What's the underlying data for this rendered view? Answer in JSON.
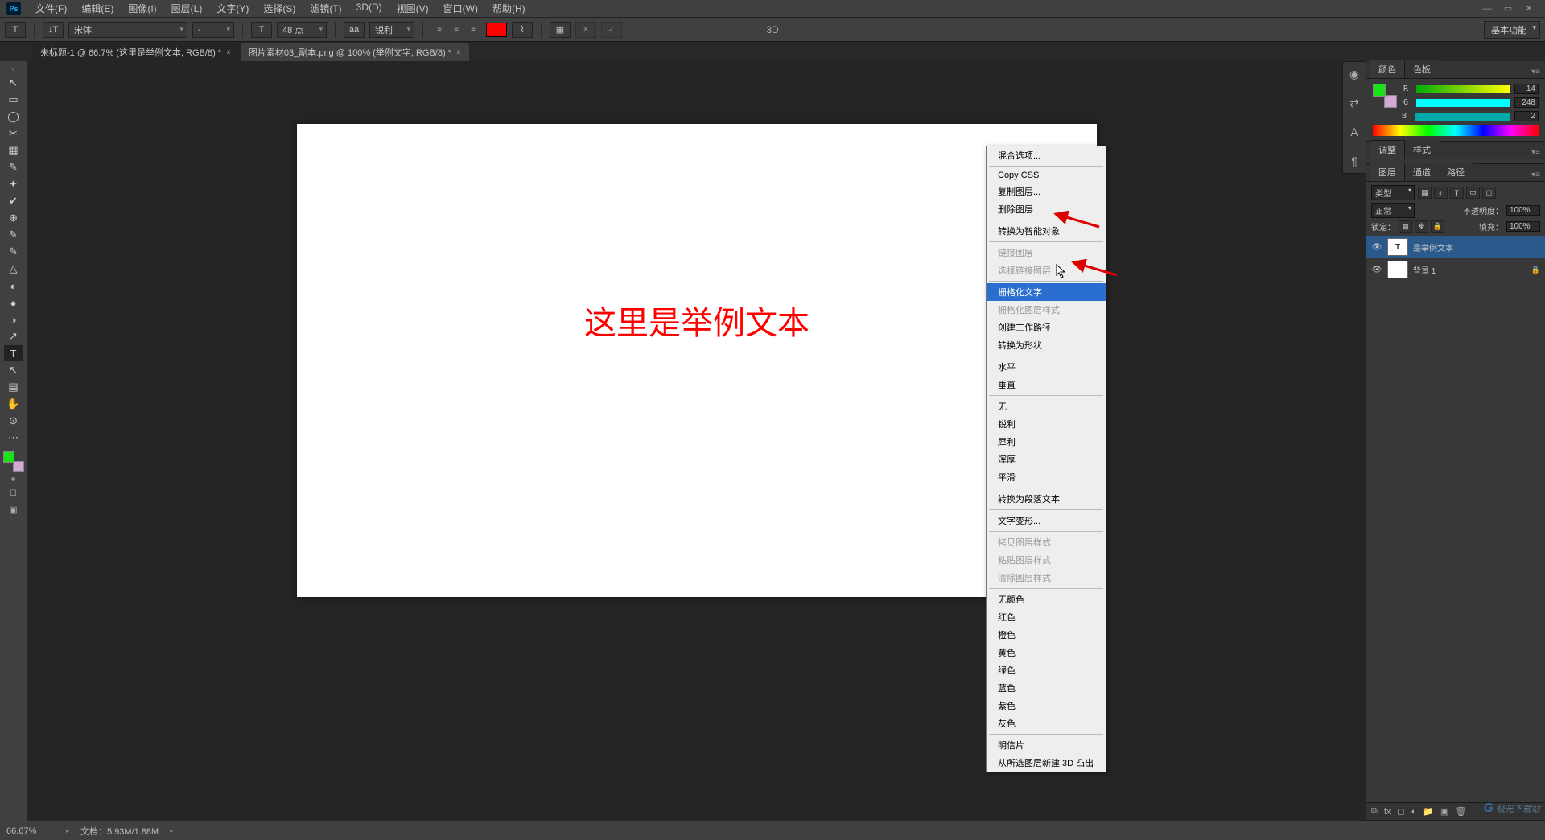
{
  "menu": {
    "file": "文件(F)",
    "edit": "编辑(E)",
    "image": "图像(I)",
    "layer": "图层(L)",
    "type": "文字(Y)",
    "select": "选择(S)",
    "filter": "滤镜(T)",
    "threeD": "3D(D)",
    "view": "视图(V)",
    "window": "窗口(W)",
    "help": "帮助(H)"
  },
  "winctrl": {
    "min": "—",
    "max": "▭",
    "close": "✕"
  },
  "options": {
    "toolT": "T",
    "orientT": "↓T",
    "font": "宋体",
    "fontStyle": "-",
    "sizeT": "T",
    "size": "48 点",
    "aa": "aa",
    "aaMode": "锐利",
    "colorSwatch": "#ff0000",
    "threeDLabel": "3D",
    "workspace": "基本功能"
  },
  "tabs": {
    "t1": "未标题-1 @ 66.7% (这里是举例文本, RGB/8) *",
    "t1close": "×",
    "t2": "图片素材03_副本.png @ 100% (举例文字, RGB/8) *",
    "t2close": "×"
  },
  "canvasText": "这里是举例文本",
  "colorPanel": {
    "tab1": "颜色",
    "tab2": "色板",
    "r": "R",
    "rVal": "14",
    "g": "G",
    "gVal": "248",
    "b": "B",
    "bVal": "2"
  },
  "adjustments": {
    "tab1": "调整",
    "tab2": "样式"
  },
  "layersPanel": {
    "tab1": "图层",
    "tab2": "通道",
    "tab3": "路径",
    "kind": "类型",
    "opacityLbl": "不透明度：",
    "opacityVal": "100%",
    "lockLbl": "锁定：",
    "fillLbl": "填充：",
    "fillVal": "100%",
    "layer1": "是举例文本",
    "layer2": "背景",
    "bgLayerName": "背景 1"
  },
  "context": [
    {
      "t": "混合选项..."
    },
    {
      "sep": true
    },
    {
      "t": "Copy CSS"
    },
    {
      "t": "复制图层..."
    },
    {
      "t": "删除图层"
    },
    {
      "sep": true
    },
    {
      "t": "转换为智能对象"
    },
    {
      "sep": true
    },
    {
      "t": "链接图层",
      "dis": true
    },
    {
      "t": "选择链接图层",
      "dis": true
    },
    {
      "sep": true
    },
    {
      "t": "栅格化文字",
      "hl": true
    },
    {
      "t": "栅格化图层样式",
      "dis": true
    },
    {
      "t": "创建工作路径"
    },
    {
      "t": "转换为形状"
    },
    {
      "sep": true
    },
    {
      "t": "水平"
    },
    {
      "t": "垂直"
    },
    {
      "sep": true
    },
    {
      "t": "无"
    },
    {
      "t": "锐利"
    },
    {
      "t": "犀利"
    },
    {
      "t": "浑厚"
    },
    {
      "t": "平滑"
    },
    {
      "sep": true
    },
    {
      "t": "转换为段落文本"
    },
    {
      "sep": true
    },
    {
      "t": "文字变形..."
    },
    {
      "sep": true
    },
    {
      "t": "拷贝图层样式",
      "dis": true
    },
    {
      "t": "粘贴图层样式",
      "dis": true
    },
    {
      "t": "清除图层样式",
      "dis": true
    },
    {
      "sep": true
    },
    {
      "t": "无颜色"
    },
    {
      "t": "红色"
    },
    {
      "t": "橙色"
    },
    {
      "t": "黄色"
    },
    {
      "t": "绿色"
    },
    {
      "t": "蓝色"
    },
    {
      "t": "紫色"
    },
    {
      "t": "灰色"
    },
    {
      "sep": true
    },
    {
      "t": "明信片"
    },
    {
      "t": "从所选图层新建 3D 凸出"
    }
  ],
  "status": {
    "zoom": "66.67%",
    "doc": "文档：5.93M/1.88M"
  },
  "tools": [
    "↖",
    "▭",
    "◯",
    "✂",
    "▦",
    "✎",
    "✦",
    "✔",
    "⊕",
    "✎",
    "✎",
    "△",
    "◐",
    "●",
    "◑",
    "↗",
    "T",
    "↖",
    "▤",
    "✋",
    "⊙",
    "⋯"
  ],
  "stripIcons": [
    "◉",
    "⇄",
    "A",
    "¶"
  ]
}
